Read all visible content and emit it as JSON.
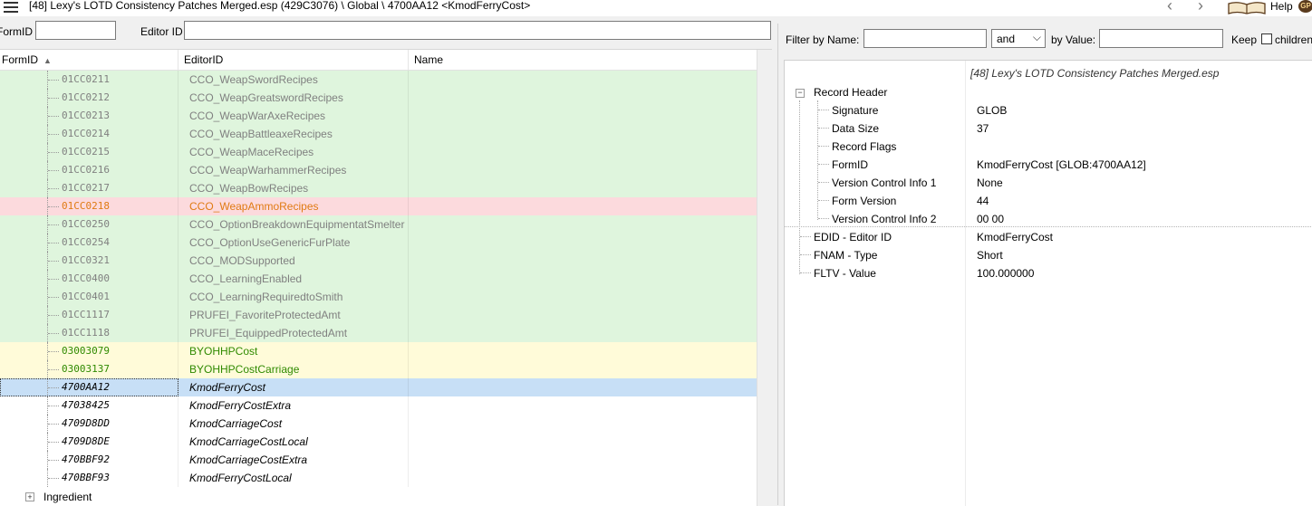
{
  "window": {
    "title": "[48] Lexy's LOTD Consistency Patches Merged.esp (429C3076) \\ Global \\ 4700AA12 <KmodFerryCost>",
    "back_icon": "chevron-left-icon",
    "forward_icon": "chevron-right-icon",
    "help_label": "Help",
    "gp_badge": "GP"
  },
  "left_filter": {
    "formid_label": "FormID",
    "formid_value": "",
    "editorid_label": "Editor ID",
    "editorid_value": ""
  },
  "grid": {
    "headers": {
      "formid": "FormID",
      "editorid": "EditorID",
      "name": "Name"
    },
    "rows": [
      {
        "formid": "01CC0211",
        "editorid": "CCO_WeapSwordRecipes",
        "status": "green"
      },
      {
        "formid": "01CC0212",
        "editorid": "CCO_WeapGreatswordRecipes",
        "status": "green"
      },
      {
        "formid": "01CC0213",
        "editorid": "CCO_WeapWarAxeRecipes",
        "status": "green"
      },
      {
        "formid": "01CC0214",
        "editorid": "CCO_WeapBattleaxeRecipes",
        "status": "green"
      },
      {
        "formid": "01CC0215",
        "editorid": "CCO_WeapMaceRecipes",
        "status": "green"
      },
      {
        "formid": "01CC0216",
        "editorid": "CCO_WeapWarhammerRecipes",
        "status": "green"
      },
      {
        "formid": "01CC0217",
        "editorid": "CCO_WeapBowRecipes",
        "status": "green"
      },
      {
        "formid": "01CC0218",
        "editorid": "CCO_WeapAmmoRecipes",
        "status": "red"
      },
      {
        "formid": "01CC0250",
        "editorid": "CCO_OptionBreakdownEquipmentatSmelter",
        "status": "green"
      },
      {
        "formid": "01CC0254",
        "editorid": "CCO_OptionUseGenericFurPlate",
        "status": "green"
      },
      {
        "formid": "01CC0321",
        "editorid": "CCO_MODSupported",
        "status": "green"
      },
      {
        "formid": "01CC0400",
        "editorid": "CCO_LearningEnabled",
        "status": "green"
      },
      {
        "formid": "01CC0401",
        "editorid": "CCO_LearningRequiredtoSmith",
        "status": "green"
      },
      {
        "formid": "01CC1117",
        "editorid": "PRUFEI_FavoriteProtectedAmt",
        "status": "green"
      },
      {
        "formid": "01CC1118",
        "editorid": "PRUFEI_EquippedProtectedAmt",
        "status": "green"
      },
      {
        "formid": "03003079",
        "editorid": "BYOHHPCost",
        "status": "yellow"
      },
      {
        "formid": "03003137",
        "editorid": "BYOHHPCostCarriage",
        "status": "yellow"
      },
      {
        "formid": "4700AA12",
        "editorid": "KmodFerryCost",
        "status": "selected"
      },
      {
        "formid": "47038425",
        "editorid": "KmodFerryCostExtra",
        "status": "white"
      },
      {
        "formid": "4709D8DD",
        "editorid": "KmodCarriageCost",
        "status": "white"
      },
      {
        "formid": "4709D8DE",
        "editorid": "KmodCarriageCostLocal",
        "status": "white"
      },
      {
        "formid": "470BBF92",
        "editorid": "KmodCarriageCostExtra",
        "status": "white"
      },
      {
        "formid": "470BBF93",
        "editorid": "KmodFerryCostLocal",
        "status": "white"
      }
    ],
    "group_label": "Ingredient"
  },
  "right_filter": {
    "name_label": "Filter by Name:",
    "name_value": "",
    "operator": "and",
    "value_label": "by Value:",
    "value_value": "",
    "keep_label": "Keep",
    "children_label": "children"
  },
  "record": {
    "file_header": "[48] Lexy's LOTD Consistency Patches Merged.esp",
    "record_header_label": "Record Header",
    "header_fields": [
      {
        "key": "Signature",
        "value": "GLOB"
      },
      {
        "key": "Data Size",
        "value": "37"
      },
      {
        "key": "Record Flags",
        "value": ""
      },
      {
        "key": "FormID",
        "value": "KmodFerryCost [GLOB:4700AA12]"
      },
      {
        "key": "Version Control Info 1",
        "value": "None"
      },
      {
        "key": "Form Version",
        "value": "44"
      },
      {
        "key": "Version Control Info 2",
        "value": "00 00"
      }
    ],
    "fields": [
      {
        "key": "EDID - Editor ID",
        "value": "KmodFerryCost"
      },
      {
        "key": "FNAM - Type",
        "value": "Short"
      },
      {
        "key": "FLTV - Value",
        "value": "100.000000"
      }
    ]
  }
}
